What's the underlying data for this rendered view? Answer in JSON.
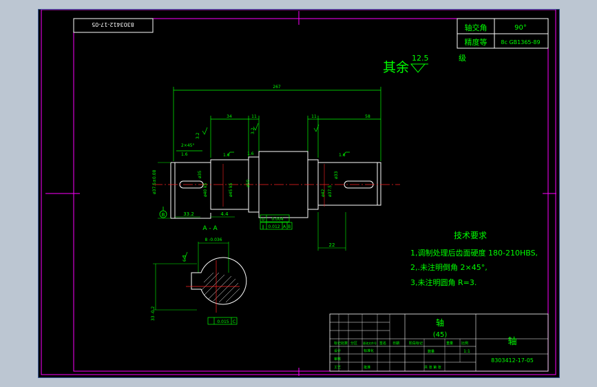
{
  "drawing": {
    "drawing_number_rotated": "8303412-17-05",
    "top_table": {
      "r1_label": "轴交角",
      "r1_value": "90°",
      "r2_label": "精度等",
      "r2_value": "8c GB1365-89"
    },
    "roughness": {
      "prefix": "其余",
      "value": "12.5",
      "suffix": "级"
    },
    "dimensions": {
      "overall": "267",
      "d34": "34",
      "d11a": "11",
      "d11b": "11",
      "d58": "58",
      "chamfer": "2×45°",
      "ra_32a": "3.2",
      "ra_32b": "3.2",
      "ra_16a": "1.6",
      "ra_16b": "1.6",
      "ra_16c": "1.6",
      "ra_16d": "1.6",
      "bottom_332": "33.2",
      "bottom_44": "4.4",
      "bottom_22": "22",
      "dia_left": "ø37.5±0.08",
      "dia_a": "ø35",
      "dia_b": "ø40 k5",
      "dia_c": "ø45 k5",
      "dia_d": "ø50",
      "dia_e": "ø42",
      "dia_f": "ø37.5",
      "dia_g": "ø33"
    },
    "tolerance": {
      "t1_sym": "◎",
      "t1_val": "0.004",
      "t2_sym": "∥",
      "t2_val": "0.012",
      "t2_ref_a": "A",
      "t2_ref_b": "B"
    },
    "datum_label": "B",
    "section": {
      "title": "A - A",
      "width_dim": "8 -0.036",
      "ra": "6.3",
      "height_dim": "33 -0.2",
      "tol_val": "0.015",
      "tol_ref": "C"
    },
    "tech": {
      "title": "技术要求",
      "line1": "1,调制处理后齿面硬度 180-210HBS,",
      "line2": "2,.未注明倒角 2×45°,",
      "line3": "3,未注明圆角 R=3."
    },
    "title_block": {
      "part_name": "轴",
      "material": "(45)",
      "drawing_name": "轴",
      "drawing_number": "8303412-17-05",
      "scale": "1:1",
      "label_scale": "比例",
      "label_qty": "数量",
      "label_mass": "重量",
      "label_mark": "标记",
      "label_count": "处数",
      "label_zone": "分区",
      "label_change": "更改文件号",
      "label_sign": "签名",
      "label_date": "日期",
      "label_design": "设计",
      "label_std": "标准化",
      "label_review": "审核",
      "label_process": "工艺",
      "label_approve": "批准",
      "label_stage": "阶段标记",
      "label_sheet": "共 张 第 张"
    }
  },
  "colors": {
    "background": "#000000",
    "frame": "#ff00ff",
    "text": "#00ff00",
    "line": "#ffffff",
    "center": "#ff2020"
  }
}
